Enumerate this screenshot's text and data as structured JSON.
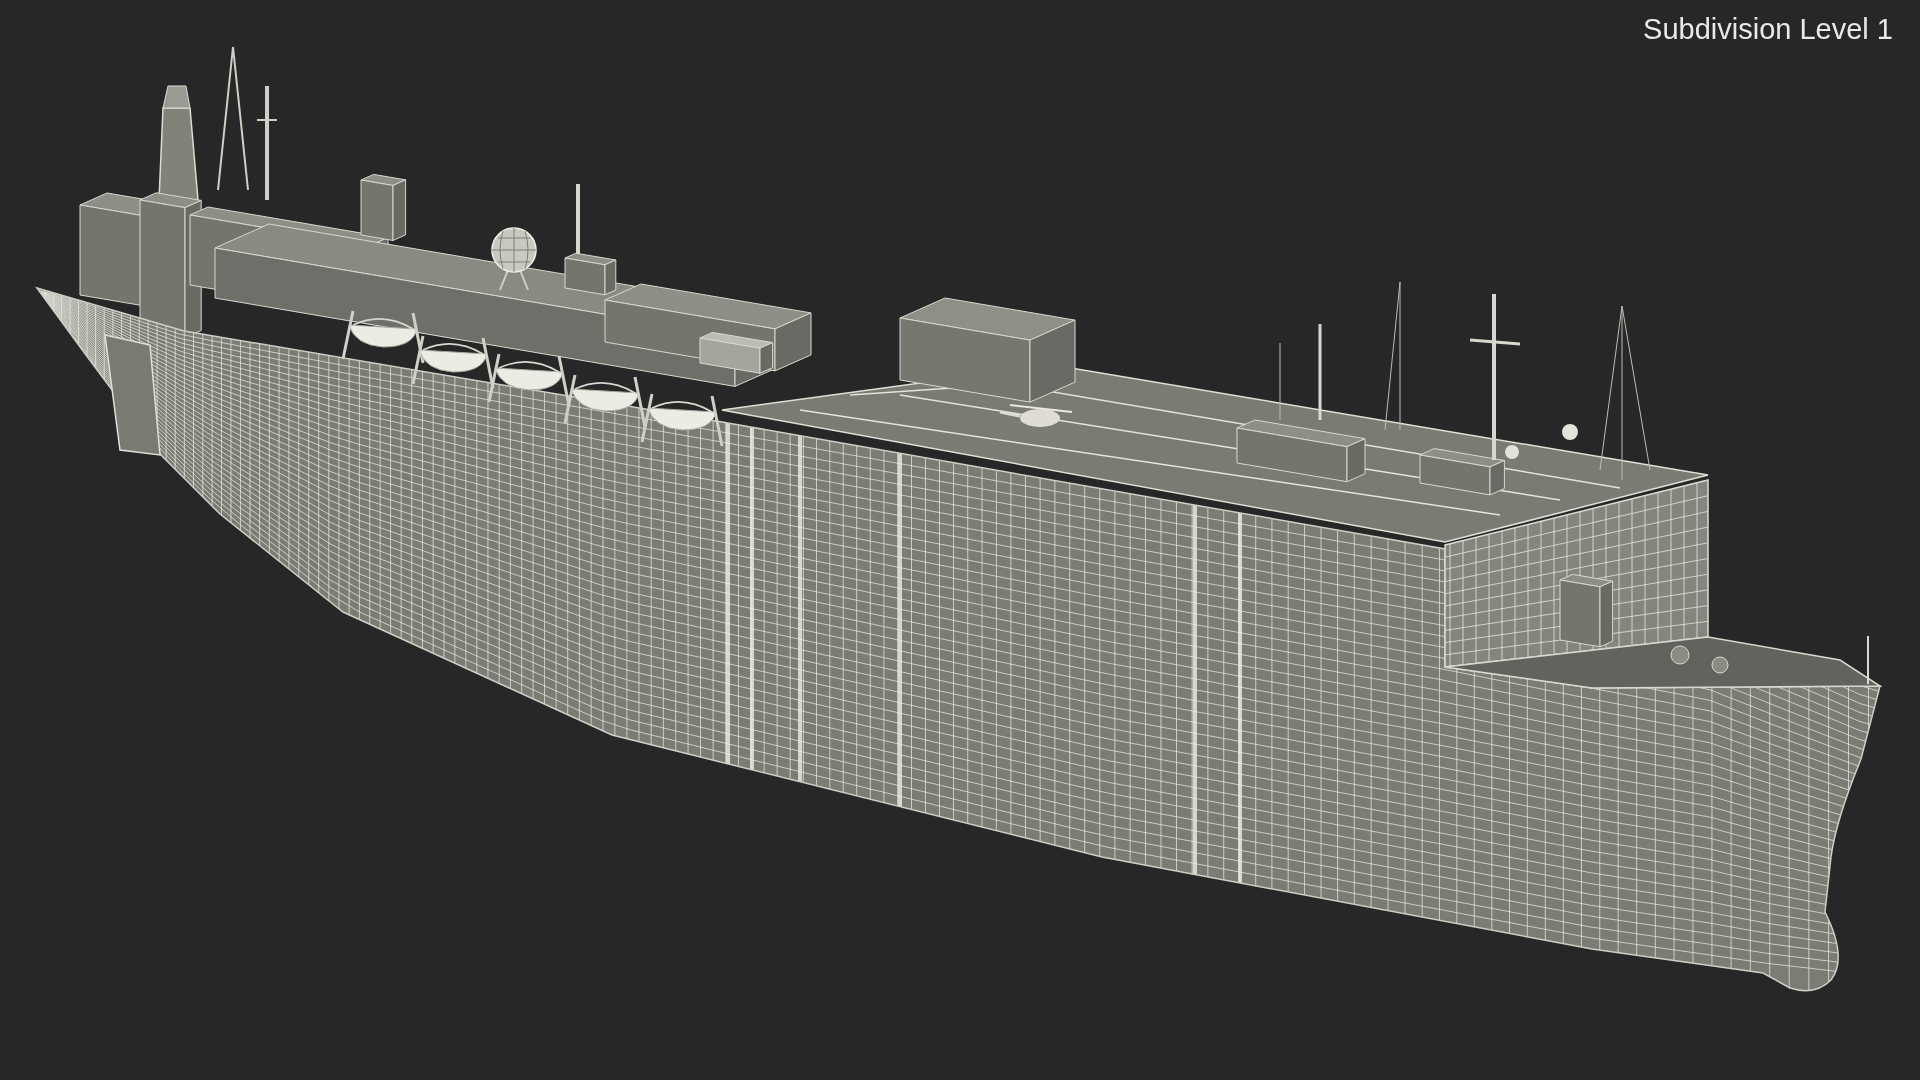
{
  "overlay": {
    "label": "Subdivision Level 1"
  }
}
